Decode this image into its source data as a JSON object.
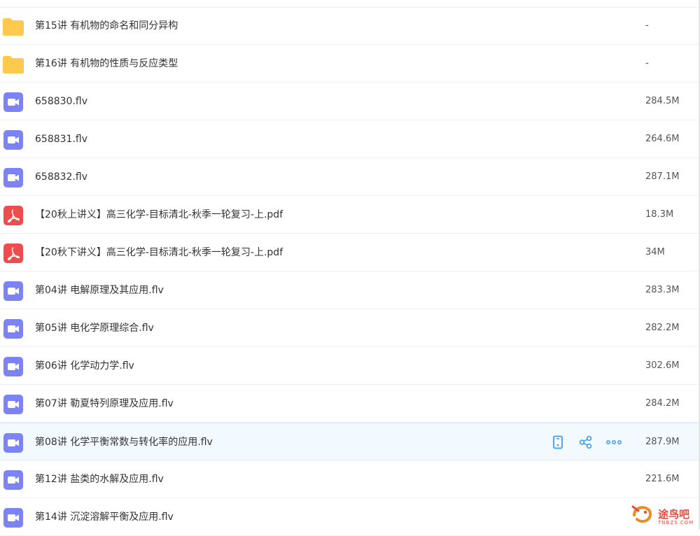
{
  "files": [
    {
      "type": "folder",
      "name": "第15讲 有机物的命名和同分异构",
      "size": "-"
    },
    {
      "type": "folder",
      "name": "第16讲 有机物的性质与反应类型",
      "size": "-"
    },
    {
      "type": "video",
      "name": "658830.flv",
      "size": "284.5M"
    },
    {
      "type": "video",
      "name": "658831.flv",
      "size": "264.6M"
    },
    {
      "type": "video",
      "name": "658832.flv",
      "size": "287.1M"
    },
    {
      "type": "pdf",
      "name": "【20秋上讲义】高三化学-目标清北-秋季一轮复习-上.pdf",
      "size": "18.3M"
    },
    {
      "type": "pdf",
      "name": "【20秋下讲义】高三化学-目标清北-秋季一轮复习-上.pdf",
      "size": "34M"
    },
    {
      "type": "video",
      "name": "第04讲 电解原理及其应用.flv",
      "size": "283.3M"
    },
    {
      "type": "video",
      "name": "第05讲 电化学原理综合.flv",
      "size": "282.2M"
    },
    {
      "type": "video",
      "name": "第06讲 化学动力学.flv",
      "size": "302.6M"
    },
    {
      "type": "video",
      "name": "第07讲 勒夏特列原理及应用.flv",
      "size": "284.2M"
    },
    {
      "type": "video",
      "name": "第08讲 化学平衡常数与转化率的应用.flv",
      "size": "287.9M",
      "hovered": true
    },
    {
      "type": "video",
      "name": "第12讲 盐类的水解及应用.flv",
      "size": "221.6M"
    },
    {
      "type": "video",
      "name": "第14讲 沉淀溶解平衡及应用.flv",
      "size": ""
    }
  ],
  "row_actions": [
    "phone-icon",
    "share-icon",
    "more-icon"
  ],
  "colors": {
    "folder": "#ffc94d",
    "video": "#7b83f5",
    "pdf": "#ef4d4d",
    "accent": "#3b9cf5"
  },
  "watermark": {
    "text": "途鸟吧",
    "sub": "TNBZS.COM"
  }
}
